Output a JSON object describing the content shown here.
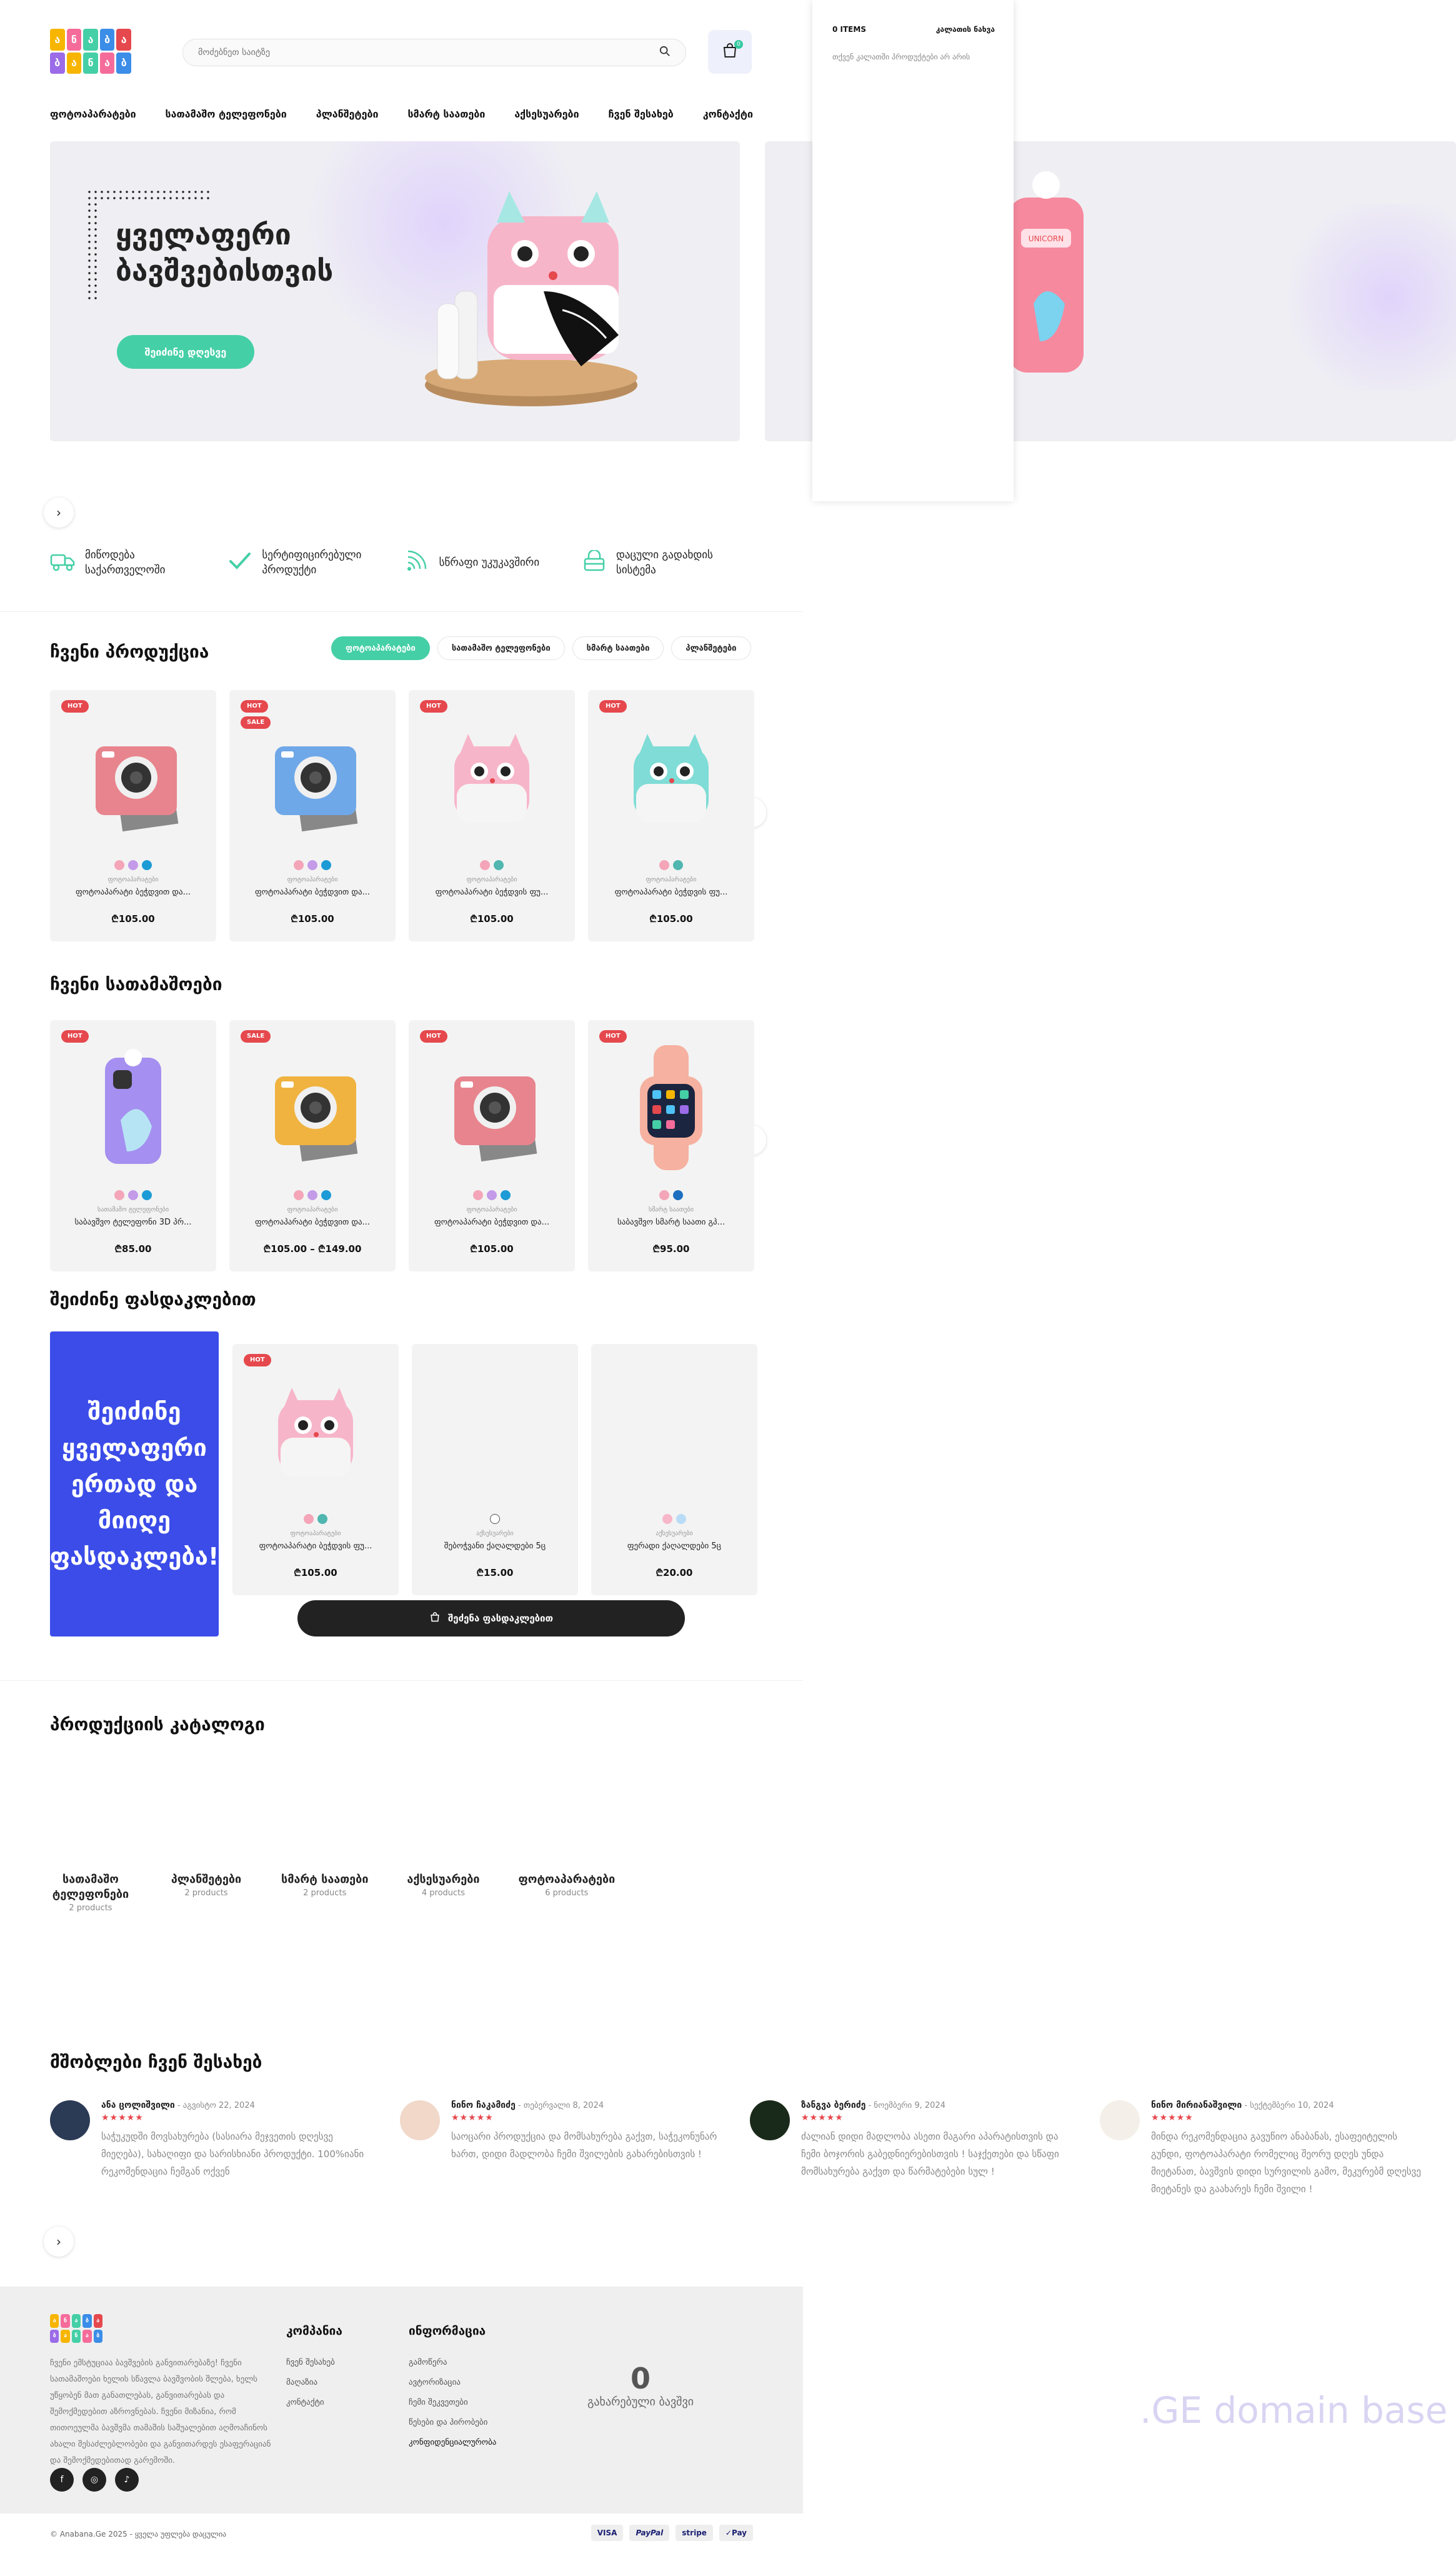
{
  "header": {
    "logo_letters": [
      "ა",
      "ნ",
      "ა",
      "ბ",
      "ა",
      "ბ",
      "ა",
      "ნ",
      "ა",
      "ბ"
    ],
    "search_placeholder": "მოძებნეთ საიტზე",
    "cart_count": "0"
  },
  "nav": [
    "ფოტოაპარატები",
    "სათამაშო ტელეფონები",
    "პლანშეტები",
    "სმარტ საათები",
    "აქსესუარები",
    "ჩვენ შესახებ",
    "კონტაქტი"
  ],
  "hero": {
    "title": "ყველაფერი ბავშვებისთვის",
    "button": "შეიძინე დღესვე"
  },
  "features": [
    "მიწოდება საქართველოში",
    "სერტიფიცირებული პროდუქტი",
    "სწრაფი უკუკავშირი",
    "დაცული გადახდის სისტემა"
  ],
  "products_section": {
    "title": "ჩვენი პროდუქცია",
    "tabs": [
      "ფოტოაპარატები",
      "სათამაშო ტელეფონები",
      "სმარტ საათები",
      "პლანშეტები"
    ],
    "items": [
      {
        "badge": "HOT",
        "badge2": "",
        "category": "ფოტოაპარატები",
        "name": "ფოტოაპარატი ბეჭდვით და...",
        "price": "₾105.00",
        "colors": [
          "#f4a5b8",
          "#c39be8",
          "#1c9bd6"
        ]
      },
      {
        "badge": "HOT",
        "badge2": "SALE",
        "category": "ფოტოაპარატები",
        "name": "ფოტოაპარატი ბეჭდვით და...",
        "price": "₾105.00",
        "colors": [
          "#f4a5b8",
          "#c39be8",
          "#1c9bd6"
        ]
      },
      {
        "badge": "HOT",
        "badge2": "",
        "category": "ფოტოაპარატები",
        "name": "ფოტოაპარატი ბეჭდვის ფუ...",
        "price": "₾105.00",
        "colors": [
          "#f4a5b8",
          "#4fb6b0"
        ]
      },
      {
        "badge": "HOT",
        "badge2": "",
        "category": "ფოტოაპარატები",
        "name": "ფოტოაპარატი ბეჭდვის ფუ...",
        "price": "₾105.00",
        "colors": [
          "#f4a5b8",
          "#4fb6b0"
        ]
      }
    ]
  },
  "toys_section": {
    "title": "ჩვენი სათამაშოები",
    "items": [
      {
        "badge": "HOT",
        "category": "სათამაშო ტელეფონები",
        "name": "საბავშვო ტელეფონი 3D პრ...",
        "price": "₾85.00",
        "colors": [
          "#f4a5b8",
          "#c39be8",
          "#1c9bd6"
        ]
      },
      {
        "badge": "SALE",
        "category": "ფოტოაპარატები",
        "name": "ფოტოაპარატი ბეჭდვით და...",
        "price": "₾105.00 – ₾149.00",
        "colors": [
          "#f4a5b8",
          "#c39be8",
          "#1c9bd6"
        ]
      },
      {
        "badge": "HOT",
        "category": "ფოტოაპარატები",
        "name": "ფოტოაპარატი ბეჭდვით და...",
        "price": "₾105.00",
        "colors": [
          "#f4a5b8",
          "#c39be8",
          "#1c9bd6"
        ]
      },
      {
        "badge": "HOT",
        "category": "სმარტ საათები",
        "name": "საბავშვო სმარტ საათი გპ...",
        "price": "₾95.00",
        "colors": [
          "#f4a5b8",
          "#1c6fbf"
        ]
      }
    ]
  },
  "bundle_section": {
    "title": "შეიძინე ფასდაკლებით",
    "promo": "შეიძინე ყველაფერი ერთად და მიიღე ფასდაკლება!",
    "items": [
      {
        "badge": "HOT",
        "category": "ფოტოაპარატები",
        "name": "ფოტოაპარატი ბეჭდვის ფუ...",
        "price": "₾105.00",
        "colors": [
          "#f4a5b8",
          "#4fb6b0"
        ]
      },
      {
        "badge": "",
        "category": "აქსესუარები",
        "name": "შებოჭვანი ქაღალდები 5ც",
        "price": "₾15.00",
        "colors": [
          "#ffffff"
        ]
      },
      {
        "badge": "",
        "category": "აქსესუარები",
        "name": "ფერადი ქაღალდები 5ც",
        "price": "₾20.00",
        "colors": [
          "#f7b7c9",
          "#b9dcf6"
        ]
      }
    ],
    "button": "შეძენა ფასდაკლებით"
  },
  "catalog": {
    "title": "პროდუქციის კატალოგი",
    "items": [
      {
        "name": "სათამაშო ტელეფონები",
        "count": "2 products"
      },
      {
        "name": "პლანშეტები",
        "count": "2 products"
      },
      {
        "name": "სმარტ საათები",
        "count": "2 products"
      },
      {
        "name": "აქსესუარები",
        "count": "4 products"
      },
      {
        "name": "ფოტოაპარატები",
        "count": "6 products"
      }
    ]
  },
  "reviews": {
    "title": "მშობლები ჩვენ შესახებ",
    "items": [
      {
        "name": "ანა ცოლიშვილი",
        "date": " - აგვისტო 22, 2024",
        "stars": "★★★★★",
        "text": "საჭუკუდში მოვსახურება (სასიარა მეჯვეთის დღესვე მიეღება), სახაღიფი და სარისხიანი პროდუქტი. 100%იანი რეკომენდაცია ჩემგან ოქვენ",
        "avatar": "#2b3a55"
      },
      {
        "name": "ნინო ჩაკამიძე",
        "date": " - თებერვალი 8, 2024",
        "stars": "★★★★★",
        "text": "საოცარი პროდუქცია და მომსახურება გაქვთ, საჭეკონუნარ ხართ, დიდი მადლობა ჩემი შვილების გახარებისთვის !",
        "avatar": "#f1d8c9"
      },
      {
        "name": "ზანგვა ბერიძე",
        "date": " - ნოემბერი 9, 2024",
        "stars": "★★★★★",
        "text": "ძალიან დიდი მადლობა ასეთი მაგარი აპარატისთვის და ჩემი ბოჯორის გაბედნიერებისთვის ! საჯქეთები და სწაფი მომსახურება გაქვთ და წარმატებები სულ !",
        "avatar": "#1a2a1a"
      },
      {
        "name": "ნინო მირიანაშვილი",
        "date": " - სექტემბერი 10, 2024",
        "stars": "★★★★★",
        "text": "მინდა რეკომენდაცია გავუწიო ანაბანას, ესაფეიტელის გუნდი, ფოტოაპარატი რომელიც შეორუ დღეს უნდა მიეტანათ, ბავშვის დიდი სურვილის გამო, მეკურებმ დღესვე მიეტანეს და გაახარეს ჩემი შვილი !",
        "avatar": "#f4efe8"
      }
    ]
  },
  "footer": {
    "about": "ჩვენი ემსტუციაა ბავშვების განვითარებაზე! ჩვენი სათამაშოები ხელის სწავლა ბავშვობის შლება, ხელს უწყობენ მათ განათლებას, განვითარებას და შემოქმედებით აზროვნებას. ჩვენი მიზანია, რომ თითოეულმა ბავშვმა თამაშის საშუალებით აღმოაჩინოს ახალი შესაძლებლობები და განვითარდეს ესაფერაციან და შემოქმედებითად გარემოში.",
    "company_title": "კომპანია",
    "company_links": [
      "ჩვენ შესახებ",
      "მაღაზია",
      "კონტაქტი"
    ],
    "info_title": "ინფორმაცია",
    "info_links": [
      "გამოწერა",
      "ავტორიზაცია",
      "ჩემი შეკვეთები",
      "წესები და პირობები",
      "კონფიდენციალურობა"
    ],
    "counter_value": "0",
    "counter_label": "გახარებული ბავშვი",
    "copyright": "© Anabana.Ge 2025 - ყველა უფლება დაცულია",
    "payments": [
      "VISA",
      "PayPal",
      "stripe",
      "✓Pay"
    ]
  },
  "side_cart": {
    "items_label": "0 ITEMS",
    "view_cart": "კალათის ნახვა",
    "empty_text": "თქვენ კალათში პროდუქტები არ არის"
  },
  "watermark": ".GE domain base"
}
